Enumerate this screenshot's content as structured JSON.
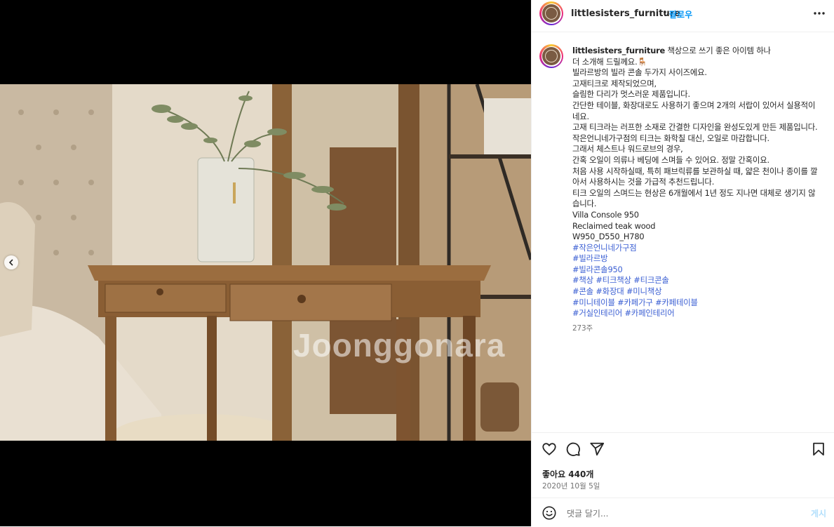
{
  "colors": {
    "link_blue": "#0095f6",
    "hashtag": "#3b5fd3",
    "text": "#262626",
    "muted": "#737373",
    "post_disabled": "#b2dffc"
  },
  "media": {
    "watermark": "Joonggonara",
    "prev_icon": "chevron-left-icon"
  },
  "header": {
    "username": "littlesisters_furniture",
    "separator": "•",
    "follow_label": "팔로우",
    "more_icon": "more-horizontal-icon"
  },
  "caption": {
    "username": "littlesisters_furniture",
    "first_line": "책상으로 쓰기 좋은 아이템 하나",
    "lines": [
      "더 소개해 드릴께요.🪑",
      "빌라르방의 빌라 콘솔 두가지 사이즈에요.",
      "고재티크로 제작되었으며,",
      "슬림한 다리가 멋스러운 제품입니다.",
      "간단한 테이블, 화장대로도 사용하기 좋으며 2개의 서랍이 있어서 실용적이네요.",
      "고재 티크라는 러프한 소재로 간결한 디자인을 완성도있게 만든 제품입니다.",
      "작은언니네가구점의 티크는 화학칠 대신, 오일로 마감합니다.",
      "그래서 체스트나 워드로브의 경우,",
      "간혹 오일이 의류나 베딩에 스며들 수 있어요. 정말 간혹이요.",
      "처음 사용 시작하실때, 특히 패브릭류를 보관하실 때, 얇은 천이나 종이를 깔아서 사용하시는 것을 가급적 추천드립니다.",
      "티크 오일의 스며드는 현상은 6개월에서 1년 정도 지나면 대체로 생기지 않습니다.",
      "Villa Console 950",
      "Reclaimed teak wood",
      "W950_D550_H780"
    ],
    "hashtag_lines": [
      [
        "#작은언니네가구점"
      ],
      [
        "#빌라르방"
      ],
      [
        "#빌라콘솔950"
      ],
      [
        "#책상",
        "#티크책상",
        "#티크콘솔"
      ],
      [
        "#콘솔",
        "#화장대",
        "#미니책상"
      ],
      [
        "#미니테이블",
        "#카페가구",
        "#카페테이블"
      ],
      [
        "#거실인테리어",
        "#카페인테리어"
      ]
    ],
    "time_ago": "273주"
  },
  "actions": {
    "like_icon": "heart-icon",
    "comment_icon": "comment-icon",
    "share_icon": "send-icon",
    "save_icon": "bookmark-icon",
    "likes_text": "좋아요 440개",
    "date_text": "2020년 10월 5일"
  },
  "comment": {
    "emoji_icon": "emoji-icon",
    "placeholder": "댓글 달기...",
    "post_label": "게시"
  }
}
